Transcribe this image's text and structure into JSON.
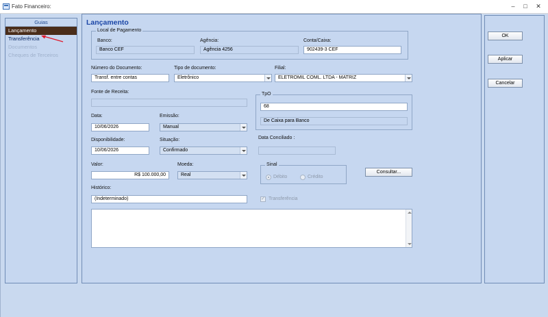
{
  "window": {
    "title": "Fato Financeiro:",
    "minimize": "–",
    "maximize": "□",
    "close": "✕"
  },
  "guias": {
    "header": "Guias",
    "items": [
      {
        "label": "Lançamento",
        "state": "active"
      },
      {
        "label": "Transferência",
        "state": "normal"
      },
      {
        "label": "Documentos",
        "state": "disabled"
      },
      {
        "label": "Cheques de Terceiros",
        "state": "disabled"
      }
    ]
  },
  "form": {
    "title": "Lançamento",
    "local_pagamento": {
      "group_title": "Local de Pagamento",
      "banco_label": "Banco:",
      "banco_value": "Banco CEF",
      "agencia_label": "Agência:",
      "agencia_value": "Agência 4256",
      "conta_label": "Conta/Caixa:",
      "conta_value": "902439-3 CEF"
    },
    "numero_documento_label": "Número do Documento:",
    "numero_documento_value": "Transf. entre contas",
    "tipo_documento_label": "Tipo de documento:",
    "tipo_documento_value": "Eletrônico",
    "filial_label": "Filial:",
    "filial_value": "ELETROMIL COML. LTDA - MATRIZ",
    "fonte_receita_label": "Fonte de Receita:",
    "fonte_receita_value": "",
    "tpo": {
      "group_title": "TpO",
      "code": "68",
      "description": "De Caixa para Banco"
    },
    "data_label": "Data:",
    "data_value": "10/06/2026",
    "emissao_label": "Emissão:",
    "emissao_value": "Manual",
    "disponibilidade_label": "Disponibilidade:",
    "disponibilidade_value": "10/06/2026",
    "situacao_label": "Situação:",
    "situacao_value": "Confirmado",
    "data_conciliado_label": "Data Conciliado :",
    "data_conciliado_value": "",
    "valor_label": "Valor:",
    "valor_value": "R$ 100.000,00",
    "moeda_label": "Moeda:",
    "moeda_value": "Real",
    "sinal": {
      "group_title": "Sinal",
      "debito": "Débito",
      "credito": "Crédito"
    },
    "consultar_label": "Consultar...",
    "historico_label": "Histórico:",
    "historico_value": "(Indeterminado)",
    "transferencia_label": "Transferência",
    "memo_value": ""
  },
  "actions": {
    "ok": "OK",
    "aplicar": "Aplicar",
    "cancelar": "Cancelar"
  },
  "colors": {
    "background": "#c9d9ef",
    "title_blue": "#1b46a6",
    "active_tab": "#4a2d1a",
    "arrow": "#e0192b"
  },
  "icons": {
    "app": "window-icon",
    "annotation": "red-arrow-icon"
  }
}
